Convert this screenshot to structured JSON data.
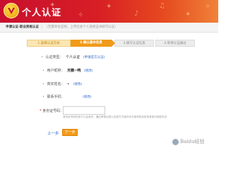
{
  "header": {
    "title": "个人认证",
    "logo_icon": "shield-v-icon",
    "gradient_colors": [
      "#c8102e",
      "#f0823a"
    ]
  },
  "subnav": {
    "current": "申请认证-职业资格认证",
    "other": "（无需单位证明，上传社会个人资格证书即可认证）"
  },
  "steps": [
    {
      "label": "1.选择认证方式",
      "state": "done"
    },
    {
      "label": "2.确认基本信息",
      "state": "active"
    },
    {
      "label": "3.填写认证信息",
      "state": "todo"
    },
    {
      "label": "4.等待认证通过",
      "state": "todo"
    }
  ],
  "form": {
    "type": {
      "label": "认证类型：",
      "value": "个人认证",
      "link": "(申请官方认证)"
    },
    "username": {
      "label": "用户昵称：",
      "value": "天鹅~鸭",
      "link": "(修改)"
    },
    "realname": {
      "label": "真实姓名：",
      "value": "•",
      "link": "(修改)"
    },
    "phone": {
      "label": "联系手机：",
      "value": "",
      "link": "(修改)"
    },
    "idcard": {
      "label": "身份证号码：",
      "required_mark": "*",
      "placeholder": "",
      "hint": "身份证号码仅用于认证身份，通过审核后将以加密方式保存本次使用的加密信息绝对保密安全"
    }
  },
  "actions": {
    "prev": "上一步",
    "next": "下一步"
  },
  "watermark": {
    "text": "Baidu经验"
  },
  "colors": {
    "accent_orange": "#f09a1a",
    "link_blue": "#2a67c8",
    "header_red": "#c8102e"
  }
}
